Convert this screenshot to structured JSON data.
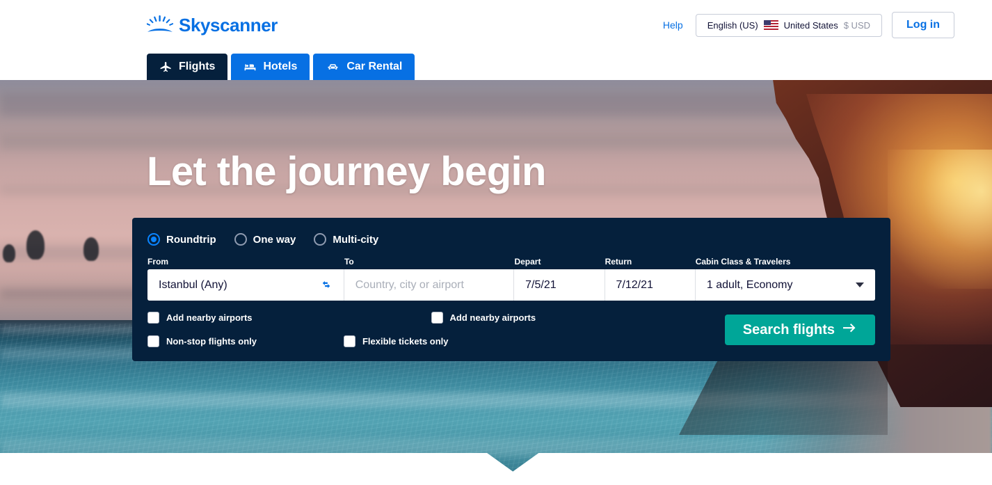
{
  "header": {
    "logo_text": "Skyscanner",
    "logo_icon": "sunburst-icon",
    "help_label": "Help",
    "locale": {
      "language": "English (US)",
      "flag_icon": "us-flag-icon",
      "country": "United States",
      "currency": "$ USD"
    },
    "login_label": "Log in"
  },
  "nav": {
    "tabs": [
      {
        "label": "Flights",
        "icon": "plane-icon",
        "active": true
      },
      {
        "label": "Hotels",
        "icon": "bed-icon",
        "active": false
      },
      {
        "label": "Car Rental",
        "icon": "car-icon",
        "active": false
      }
    ]
  },
  "hero": {
    "title": "Let the journey begin"
  },
  "search": {
    "trip_types": [
      {
        "label": "Roundtrip",
        "selected": true
      },
      {
        "label": "One way",
        "selected": false
      },
      {
        "label": "Multi-city",
        "selected": false
      }
    ],
    "labels": {
      "from": "From",
      "to": "To",
      "depart": "Depart",
      "return": "Return",
      "cabin": "Cabin Class & Travelers"
    },
    "values": {
      "from": "Istanbul (Any)",
      "to": "",
      "to_placeholder": "Country, city or airport",
      "depart": "7/5/21",
      "return": "7/12/21",
      "cabin": "1 adult, Economy"
    },
    "icons": {
      "swap": "swap-icon",
      "cabin_caret": "chevron-down-icon",
      "search_arrow": "arrow-right-icon"
    },
    "checkboxes": [
      {
        "label": "Add nearby airports",
        "checked": false
      },
      {
        "label": "Add nearby airports",
        "checked": false
      },
      {
        "label": "Non-stop flights only",
        "checked": false
      },
      {
        "label": "Flexible tickets only",
        "checked": false
      }
    ],
    "search_button_label": "Search flights"
  },
  "colors": {
    "brand_blue": "#0770e3",
    "dark_navy": "#05203c",
    "teal": "#00a698",
    "radio_blue": "#0a84ff",
    "muted_grey": "#8f93a3"
  }
}
